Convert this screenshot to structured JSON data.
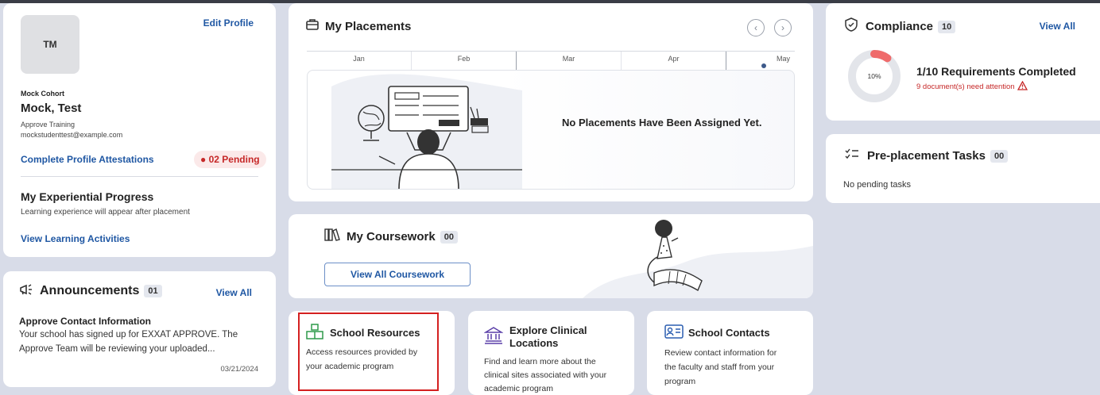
{
  "profile": {
    "initials": "TM",
    "edit_label": "Edit Profile",
    "cohort": "Mock Cohort",
    "name": "Mock, Test",
    "program": "Approve Training",
    "email": "mockstudenttest@example.com",
    "attestations_link": "Complete Profile Attestations",
    "pending_badge": "02 Pending",
    "progress_title": "My Experiential Progress",
    "progress_desc": "Learning experience will appear after placement",
    "activities_link": "View Learning Activities"
  },
  "announcements": {
    "title": "Announcements",
    "count": "01",
    "view_all": "View All",
    "item_title": "Approve Contact Information",
    "item_body_1": "Your school has signed up for EXXAT APPROVE. The",
    "item_body_2": "Approve Team will be reviewing your uploaded...",
    "item_date": "03/21/2024"
  },
  "placements": {
    "title": "My Placements",
    "months": [
      "Jan",
      "Feb",
      "Mar",
      "Apr",
      "May"
    ],
    "empty_message": "No Placements Have Been Assigned Yet."
  },
  "coursework": {
    "title": "My Coursework",
    "count": "00",
    "button_label": "View All Coursework"
  },
  "tiles": [
    {
      "title": "School Resources",
      "desc_1": "Access resources provided by",
      "desc_2": "your academic program",
      "desc_3": ""
    },
    {
      "title": "Explore Clinical",
      "title_2": "Locations",
      "desc_1": "Find and learn more about the",
      "desc_2": "clinical sites associated with your",
      "desc_3": "academic program"
    },
    {
      "title": "School Contacts",
      "desc_1": "Review contact information for",
      "desc_2": "the faculty and staff from your",
      "desc_3": "program"
    }
  ],
  "compliance": {
    "title": "Compliance",
    "count": "10",
    "view_all": "View All",
    "percent_label": "10%",
    "percent_value": 0.1,
    "requirements": "1/10 Requirements Completed",
    "attention": "9 document(s) need attention"
  },
  "preplacement": {
    "title": "Pre-placement Tasks",
    "count": "00",
    "empty": "No pending tasks"
  },
  "colors": {
    "accent": "#1f57a3",
    "danger": "#c62828",
    "progress": "#ef6b6b",
    "highlight_box": "#d42020"
  }
}
